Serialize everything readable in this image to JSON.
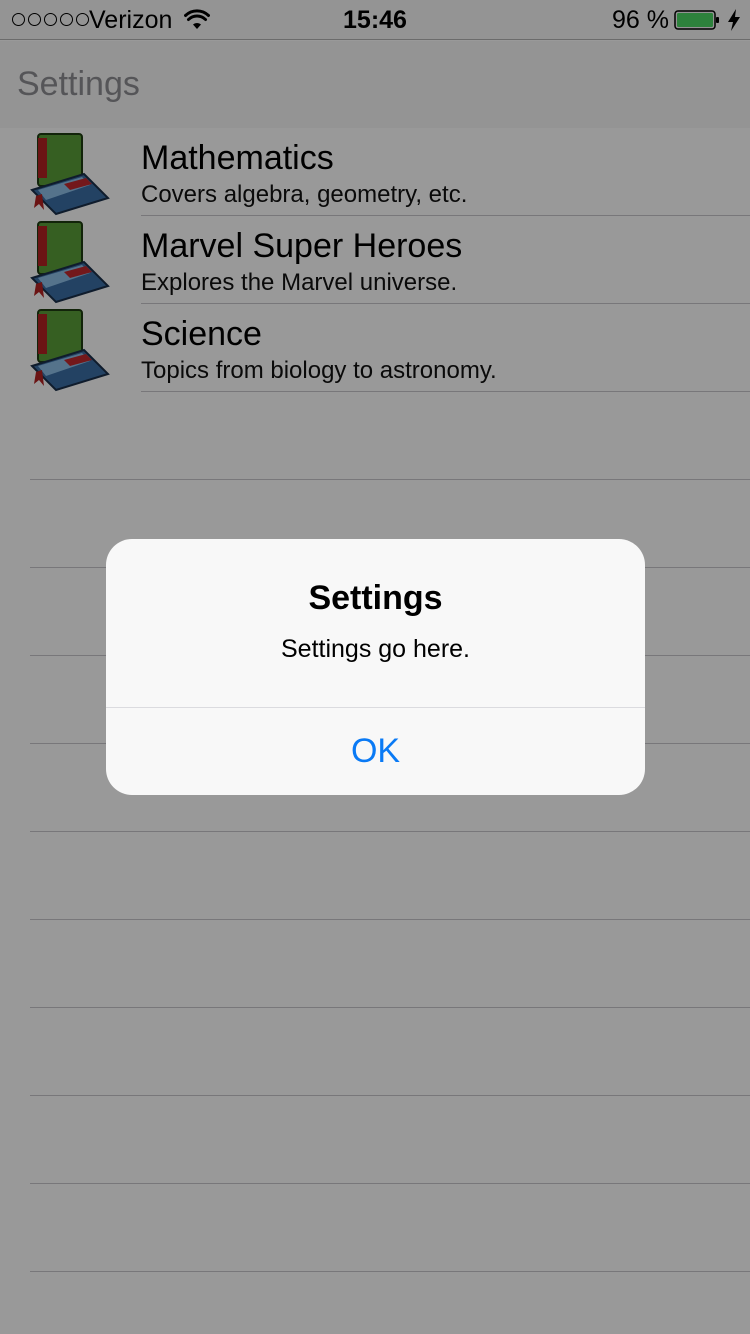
{
  "status_bar": {
    "carrier": "Verizon",
    "time": "15:46",
    "battery_percent": "96 %",
    "battery_level": 0.96,
    "signal_icon": "signal-dots-icon",
    "wifi_icon": "wifi-icon",
    "charging_icon": "charging-bolt-icon"
  },
  "nav": {
    "title": "Settings"
  },
  "list": {
    "items": [
      {
        "title": "Mathematics",
        "subtitle": "Covers algebra, geometry, etc.",
        "icon": "book-icon"
      },
      {
        "title": "Marvel Super Heroes",
        "subtitle": "Explores the Marvel universe.",
        "icon": "book-icon"
      },
      {
        "title": "Science",
        "subtitle": "Topics from biology to astronomy.",
        "icon": "book-icon"
      }
    ]
  },
  "alert": {
    "title": "Settings",
    "message": "Settings go here.",
    "button_label": "OK"
  },
  "colors": {
    "accent": "#0a7af5",
    "battery": "#4cd964",
    "overlay": "rgba(0,0,0,0.4)"
  }
}
